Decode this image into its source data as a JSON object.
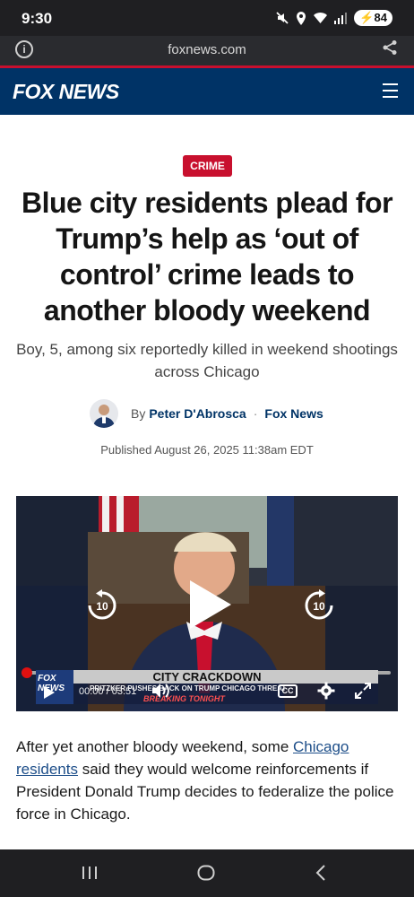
{
  "status_bar": {
    "time": "9:30",
    "battery": "84",
    "icons": [
      "mute-icon",
      "location-icon",
      "wifi-icon",
      "signal-icon",
      "battery-icon"
    ]
  },
  "browser": {
    "url": "foxnews.com"
  },
  "header": {
    "logo_text": "FOX NEWS",
    "menu_icon": "hamburger-icon"
  },
  "article": {
    "category": "CRIME",
    "headline": "Blue city residents plead for Trump’s help as ‘out of control’ crime leads to another bloody weekend",
    "subheadline": "Boy, 5, among six reportedly killed in weekend shootings across Chicago",
    "byline_prefix": "By",
    "author": "Peter D'Abrosca",
    "separator": "·",
    "outlet": "Fox News",
    "published": "Published August 26, 2025 11:38am EDT"
  },
  "video": {
    "time_current": "00:00",
    "time_total": "03:51",
    "time_sep": "/",
    "skip_back_label": "10",
    "skip_forward_label": "10",
    "progress": 0,
    "captions_label": "CC",
    "lower_third_title": "CITY CRACKDOWN",
    "lower_third_sub": "PRITZKER PUSHES BACK ON TRUMP CHICAGO THREAT",
    "lower_third_tag": "BREAKING TONIGHT",
    "bug_text": "FOX NEWS"
  },
  "body": {
    "p1_start": "After yet another bloody weekend, some ",
    "p1_link": "Chicago residents",
    "p1_end": " said they would welcome reinforcements if President Donald Trump decides to federalize the police force in Chicago."
  },
  "colors": {
    "fox_navy": "#003366",
    "crime_red": "#c8102e",
    "link_blue": "#1d4e89"
  }
}
